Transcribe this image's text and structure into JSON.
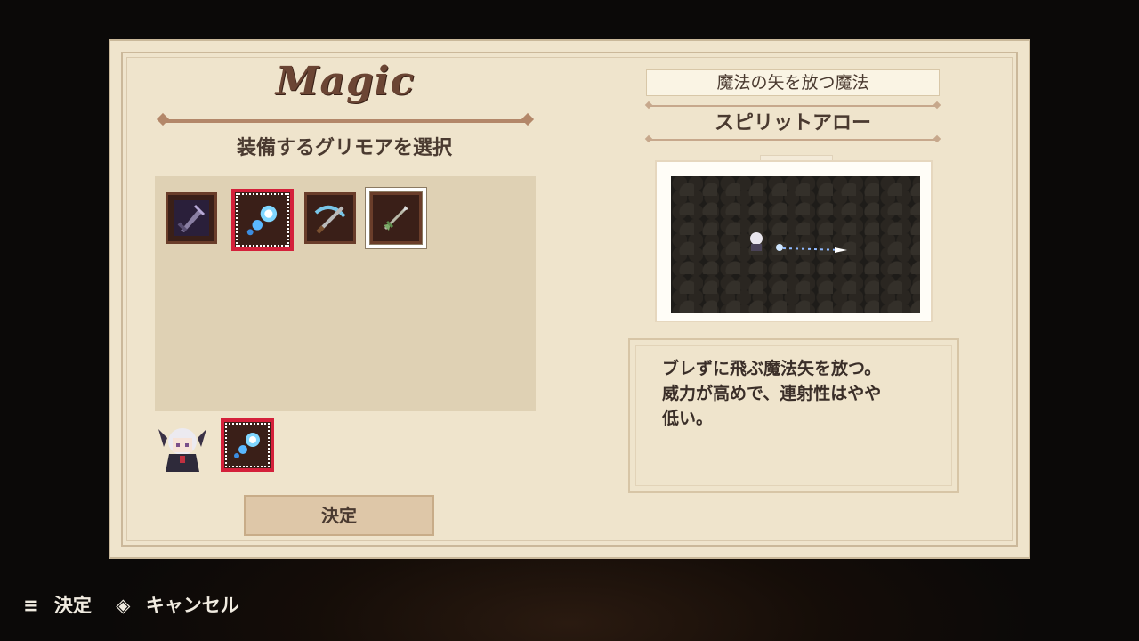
{
  "screen": {
    "title": "Magic",
    "subtitle": "装備するグリモアを選択",
    "grimoires": [
      {
        "name": "dark-sword",
        "icon": "dark-sword-icon",
        "selected": false
      },
      {
        "name": "spirit-orb",
        "icon": "spirit-orb-icon",
        "selected": true
      },
      {
        "name": "crossbow",
        "icon": "crossbow-icon",
        "selected": false
      },
      {
        "name": "arrow",
        "icon": "arrow-icon",
        "selected": false,
        "cursor": true
      }
    ],
    "equipped_icon": "spirit-orb-icon",
    "confirm_label": "決定"
  },
  "detail": {
    "category": "魔法の矢を放つ魔法",
    "name": "スピリットアロー",
    "description": "ブレずに飛ぶ魔法矢を放つ。\n威力が高めで、連射性はやや\n低い。"
  },
  "footer": {
    "confirm": "決定",
    "cancel": "キャンセル"
  },
  "colors": {
    "panel": "#efe4cc",
    "accent_red": "#d4203a",
    "text_brown": "#4a3a30"
  }
}
